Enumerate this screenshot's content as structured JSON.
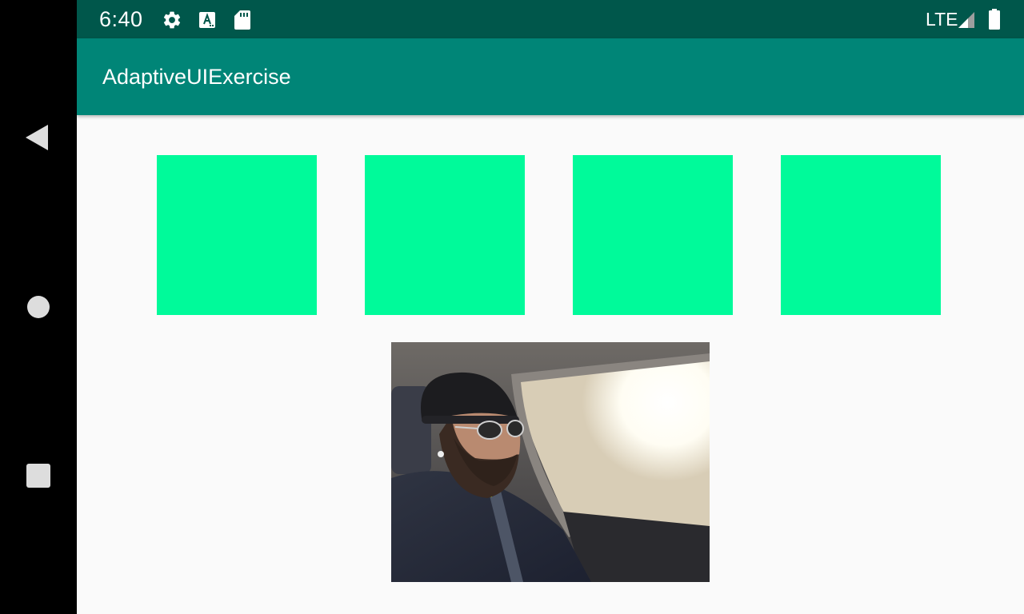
{
  "status_bar": {
    "time": "6:40",
    "network": "LTE",
    "icons": [
      "settings-icon",
      "font-download-icon",
      "sd-card-icon",
      "signal-icon",
      "battery-icon"
    ]
  },
  "app_bar": {
    "title": "AdaptiveUIExercise"
  },
  "nav_bar": {
    "buttons": [
      "back",
      "home",
      "recents"
    ]
  },
  "content": {
    "boxes": [
      {
        "color": "#00fa9a"
      },
      {
        "color": "#00fa9a"
      },
      {
        "color": "#00fa9a"
      },
      {
        "color": "#00fa9a"
      }
    ],
    "photo": {
      "subject": "person-in-car-photo"
    }
  },
  "colors": {
    "status_bar": "#00574b",
    "app_bar": "#008577",
    "accent_green": "#00fa9a",
    "background": "#fafafa"
  }
}
